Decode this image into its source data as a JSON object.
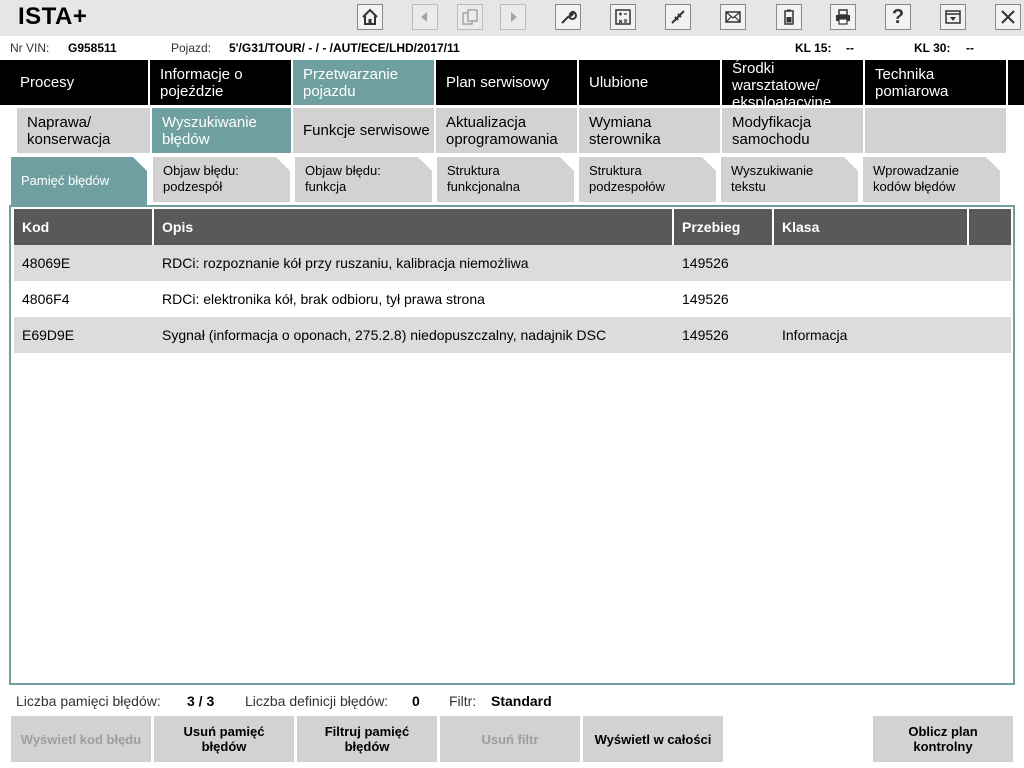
{
  "app": {
    "title": "ISTA+"
  },
  "vehicle": {
    "vin_label": "Nr VIN:",
    "vin": "G958511",
    "vehicle_label": "Pojazd:",
    "vehicle": "5'/G31/TOUR/ - / - /AUT/ECE/LHD/2017/11",
    "kl15_label": "KL 15:",
    "kl15": "--",
    "kl30_label": "KL 30:",
    "kl30": "--"
  },
  "toolbar": {
    "icons": [
      "home-icon",
      "back-icon",
      "copy-icon",
      "forward-icon",
      "wrench-icon",
      "calculator-icon",
      "connection-icon",
      "mail-icon",
      "battery-icon",
      "print-icon",
      "help-icon",
      "minimize-icon",
      "close-icon"
    ],
    "help_glyph": "?"
  },
  "main_nav": [
    {
      "label": "Procesy"
    },
    {
      "label": "Informacje o pojeździe"
    },
    {
      "label": "Przetwarzanie pojazdu",
      "active": true
    },
    {
      "label": "Plan serwisowy"
    },
    {
      "label": "Ulubione"
    },
    {
      "label": "Środki warsztatowe/ eksploatacyjne"
    },
    {
      "label": "Technika pomiarowa"
    }
  ],
  "sub_nav": [
    {
      "label": "Naprawa/ konserwacja"
    },
    {
      "label": "Wyszukiwanie błędów",
      "active": true
    },
    {
      "label": "Funkcje serwisowe"
    },
    {
      "label": "Aktualizacja oprogramowania"
    },
    {
      "label": "Wymiana sterownika"
    },
    {
      "label": "Modyfikacja samochodu"
    },
    {
      "label": ""
    }
  ],
  "tabs": [
    {
      "label": "Pamięć błędów",
      "active": true
    },
    {
      "label": "Objaw błędu: podzespół"
    },
    {
      "label": "Objaw błędu: funkcja"
    },
    {
      "label": "Struktura funkcjonalna"
    },
    {
      "label": "Struktura podzespołów"
    },
    {
      "label": "Wyszukiwanie tekstu"
    },
    {
      "label": "Wprowadzanie kodów błędów"
    }
  ],
  "table": {
    "headers": [
      "Kod",
      "Opis",
      "Przebieg",
      "Klasa",
      ""
    ],
    "rows": [
      {
        "kod": "48069E",
        "opis": "RDCi: rozpoznanie kół przy ruszaniu, kalibracja niemożliwa",
        "przebieg": "149526",
        "klasa": ""
      },
      {
        "kod": "4806F4",
        "opis": "RDCi: elektronika kół, brak odbioru, tył prawa strona",
        "przebieg": "149526",
        "klasa": ""
      },
      {
        "kod": "E69D9E",
        "opis": "Sygnał (informacja o oponach, 275.2.8) niedopuszczalny, nadajnik DSC",
        "przebieg": "149526",
        "klasa": "Informacja"
      }
    ]
  },
  "status": {
    "count_label": "Liczba pamięci błędów:",
    "count": "3 / 3",
    "def_label": "Liczba definicji błędów:",
    "def": "0",
    "filter_label": "Filtr:",
    "filter": "Standard"
  },
  "buttons": [
    {
      "label": "Wyświetl kod błędu",
      "disabled": true
    },
    {
      "label": "Usuń pamięć błędów"
    },
    {
      "label": "Filtruj pamięć błędów"
    },
    {
      "label": "Usuń filtr",
      "disabled": true
    },
    {
      "label": "Wyświetl w całości"
    },
    {
      "label": "Oblicz plan kontrolny"
    }
  ]
}
